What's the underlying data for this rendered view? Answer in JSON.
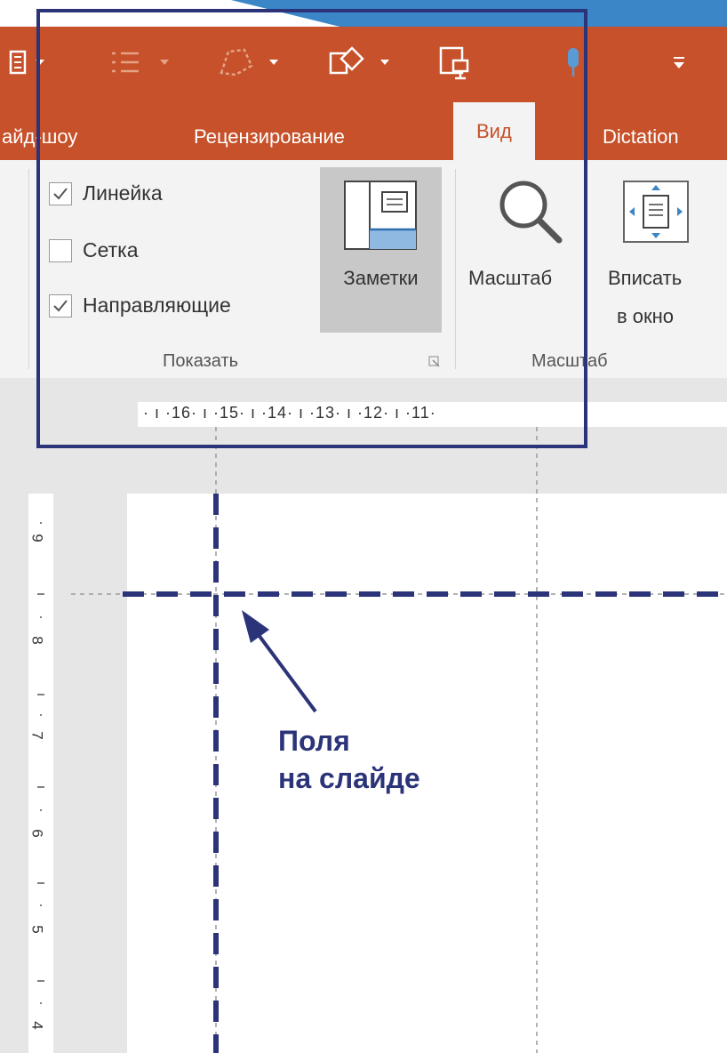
{
  "tabs": [
    {
      "label": "айд-шоу",
      "active": false
    },
    {
      "label": "Рецензирование",
      "active": false
    },
    {
      "label": "Вид",
      "active": true
    },
    {
      "label": "Dictation",
      "active": false
    }
  ],
  "show_group": {
    "checkboxes": [
      {
        "label": "Линейка",
        "checked": true
      },
      {
        "label": "Сетка",
        "checked": false
      },
      {
        "label": "Направляющие",
        "checked": true
      }
    ],
    "notes_label": "Заметки",
    "label": "Показать"
  },
  "zoom_group": {
    "zoom_label": "Масштаб",
    "fit_label_line1": "Вписать",
    "fit_label_line2": "в окно",
    "label": "Масштаб"
  },
  "ruler": {
    "horizontal": "· ı ·16· ı ·15· ı ·14· ı ·13· ı ·12· ı ·11·",
    "vertical_numbers": [
      "9",
      "8",
      "7",
      "6",
      "5",
      "4"
    ]
  },
  "annotation": {
    "line1": "Поля",
    "line2": "на слайде"
  },
  "colors": {
    "ribbon_accent": "#c6512a",
    "annotation": "#2c3479"
  }
}
